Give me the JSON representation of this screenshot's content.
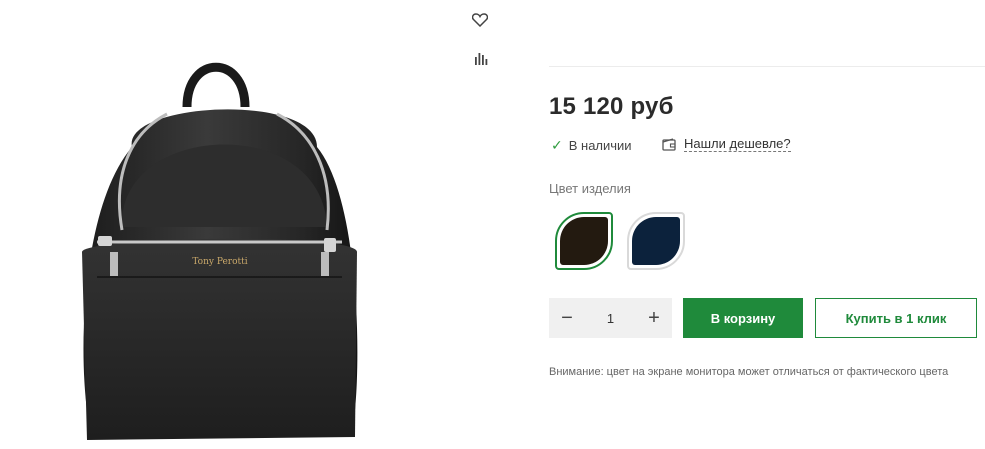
{
  "product": {
    "image_alt": "Tony Perotti backpack",
    "brand_mark": "Tony Perotti"
  },
  "actions": {
    "favorite_icon": "heart-icon",
    "compare_icon": "bar-chart-icon"
  },
  "price": {
    "text": "15 120 руб"
  },
  "availability": {
    "text": "В наличии",
    "icon": "check-icon"
  },
  "cheaper": {
    "text": "Нашли дешевле?",
    "icon": "wallet-icon"
  },
  "color": {
    "label": "Цвет изделия",
    "swatches": [
      {
        "hex": "#231a10",
        "selected": true
      },
      {
        "hex": "#0c223c",
        "selected": false
      }
    ],
    "accent": "#1f8a3b"
  },
  "quantity": {
    "value": "1",
    "minus": "−",
    "plus": "+"
  },
  "buttons": {
    "cart": "В корзину",
    "one_click": "Купить в 1 клик"
  },
  "note": {
    "text": "Внимание: цвет на экране монитора может отличаться от фактического цвета"
  }
}
